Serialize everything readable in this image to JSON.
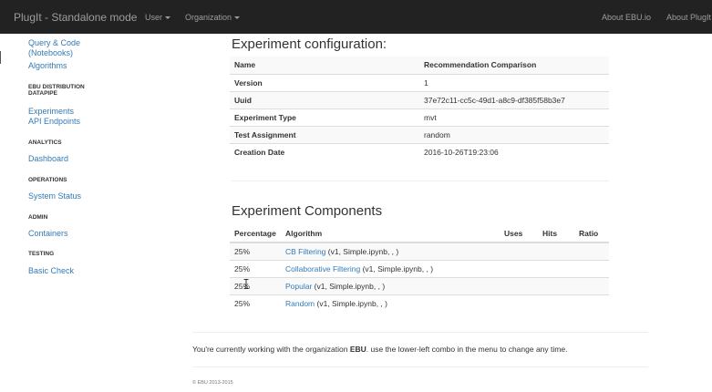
{
  "navbar": {
    "brand": "PlugIt - Standalone mode",
    "user_menu": "User",
    "organization_menu": "Organization",
    "about_ebu": "About EBU.io",
    "about_plugit": "About PlugIt"
  },
  "sidebar": {
    "query_code": "Query & Code",
    "notebooks": "(Notebooks)",
    "algorithms": "Algorithms",
    "ebu_distribution_1": "EBU DISTRIBUTION",
    "ebu_distribution_2": "DATAPIPE",
    "experiments": "Experiments",
    "api_endpoints": "API Endpoints",
    "analytics": "ANALYTICS",
    "dashboard": "Dashboard",
    "operations": "OPERATIONS",
    "system_status": "System Status",
    "admin": "ADMIN",
    "containers": "Containers",
    "testing": "TESTING",
    "basic_check": "Basic Check"
  },
  "config": {
    "title": "Experiment configuration:",
    "rows": [
      {
        "key": "Name",
        "value": "Recommendation Comparison"
      },
      {
        "key": "Version",
        "value": "1"
      },
      {
        "key": "Uuid",
        "value": "37e72c11-cc5c-49d1-a8c9-df385f58b3e7"
      },
      {
        "key": "Experiment Type",
        "value": "mvt"
      },
      {
        "key": "Test Assignment",
        "value": "random"
      },
      {
        "key": "Creation Date",
        "value": "2016-10-26T19:23:06"
      }
    ]
  },
  "components": {
    "title": "Experiment Components",
    "headers": {
      "percentage": "Percentage",
      "algorithm": "Algorithm",
      "uses": "Uses",
      "hits": "Hits",
      "ratio": "Ratio"
    },
    "rows": [
      {
        "percentage": "25%",
        "algorithm": "CB Filtering",
        "details": " (v1, Simple.ipynb, , )",
        "uses": "",
        "hits": "",
        "ratio": ""
      },
      {
        "percentage": "25%",
        "algorithm": "Collaborative Filtering",
        "details": " (v1, Simple.ipynb, , )",
        "uses": "",
        "hits": "",
        "ratio": ""
      },
      {
        "percentage": "25%",
        "algorithm": "Popular",
        "details": " (v1, Simple.ipynb, , )",
        "uses": "",
        "hits": "",
        "ratio": ""
      },
      {
        "percentage": "25%",
        "algorithm": "Random",
        "details": " (v1, Simple.ipynb, , )",
        "uses": "",
        "hits": "",
        "ratio": ""
      }
    ]
  },
  "footer": {
    "prefix": "You're currently working with the organization ",
    "org": "EBU",
    "suffix": ". use the lower-left combo in the menu to change any time.",
    "copyright": "© EBU 2013-2015"
  },
  "icons": {
    "caret": "caret-down-icon",
    "cursor": "text-cursor-icon"
  },
  "colors": {
    "navbar_bg": "#222222",
    "link": "#337ab7",
    "text": "#333333"
  }
}
